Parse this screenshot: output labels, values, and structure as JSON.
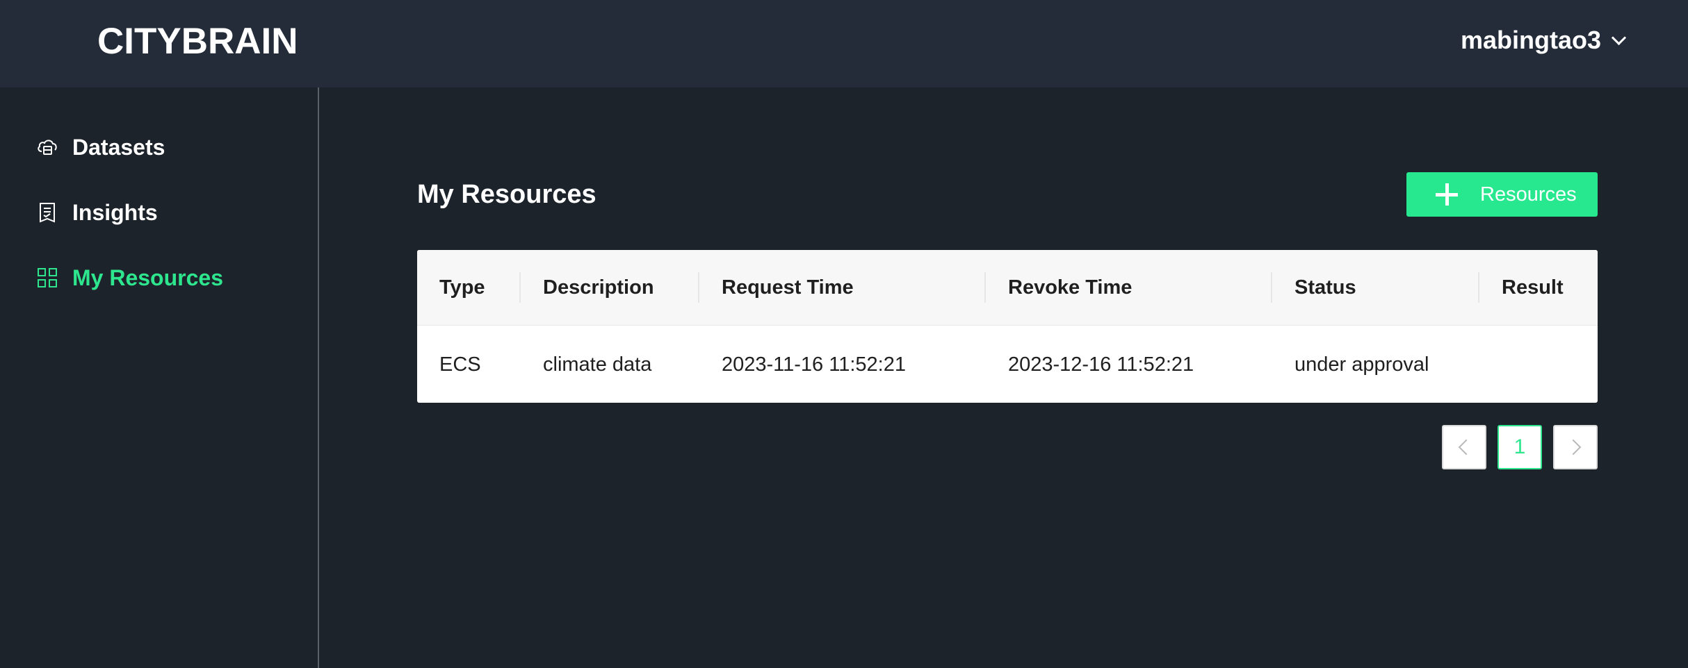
{
  "header": {
    "logo": "CITYBRAIN",
    "user": "mabingtao3"
  },
  "sidebar": {
    "items": [
      {
        "label": "Datasets",
        "icon": "cloud-database-icon",
        "active": false
      },
      {
        "label": "Insights",
        "icon": "report-icon",
        "active": false
      },
      {
        "label": "My Resources",
        "icon": "grid-icon",
        "active": true
      }
    ]
  },
  "main": {
    "title": "My Resources",
    "add_button_label": "Resources",
    "table": {
      "columns": [
        "Type",
        "Description",
        "Request Time",
        "Revoke Time",
        "Status",
        "Result"
      ],
      "rows": [
        [
          "ECS",
          "climate data",
          "2023-11-16 11:52:21",
          "2023-12-16 11:52:21",
          "under approval",
          ""
        ]
      ]
    },
    "pagination": {
      "current_page": "1"
    }
  },
  "colors": {
    "accent": "#27e88f",
    "background": "#1d232b",
    "header": "#232c38"
  }
}
